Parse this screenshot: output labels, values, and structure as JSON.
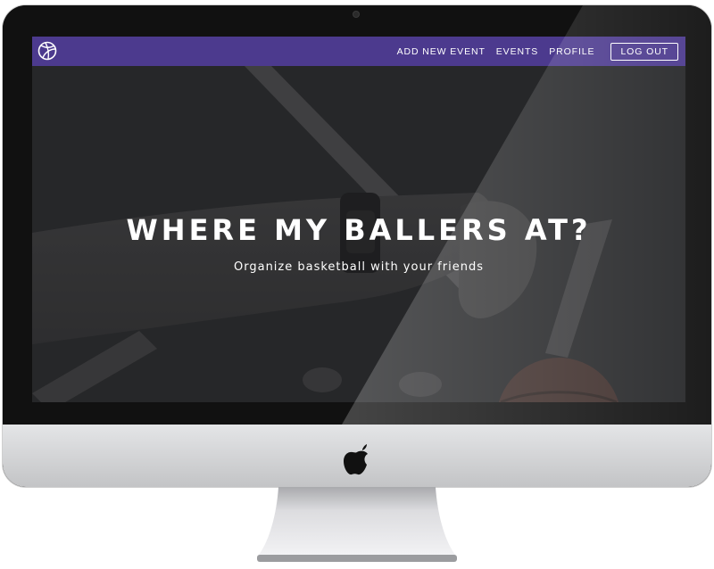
{
  "nav": {
    "brand_icon": "basketball-icon",
    "links": [
      "ADD NEW EVENT",
      "EVENTS",
      "PROFILE"
    ],
    "logout_label": "LOG OUT"
  },
  "hero": {
    "title": "WHERE MY BALLERS AT?",
    "subtitle": "Organize basketball with your friends"
  },
  "device": {
    "logo_icon": "apple-logo-icon"
  },
  "colors": {
    "navbar": "#4c3a8e",
    "hero_overlay": "#2b2c2e",
    "text": "#ffffff"
  }
}
